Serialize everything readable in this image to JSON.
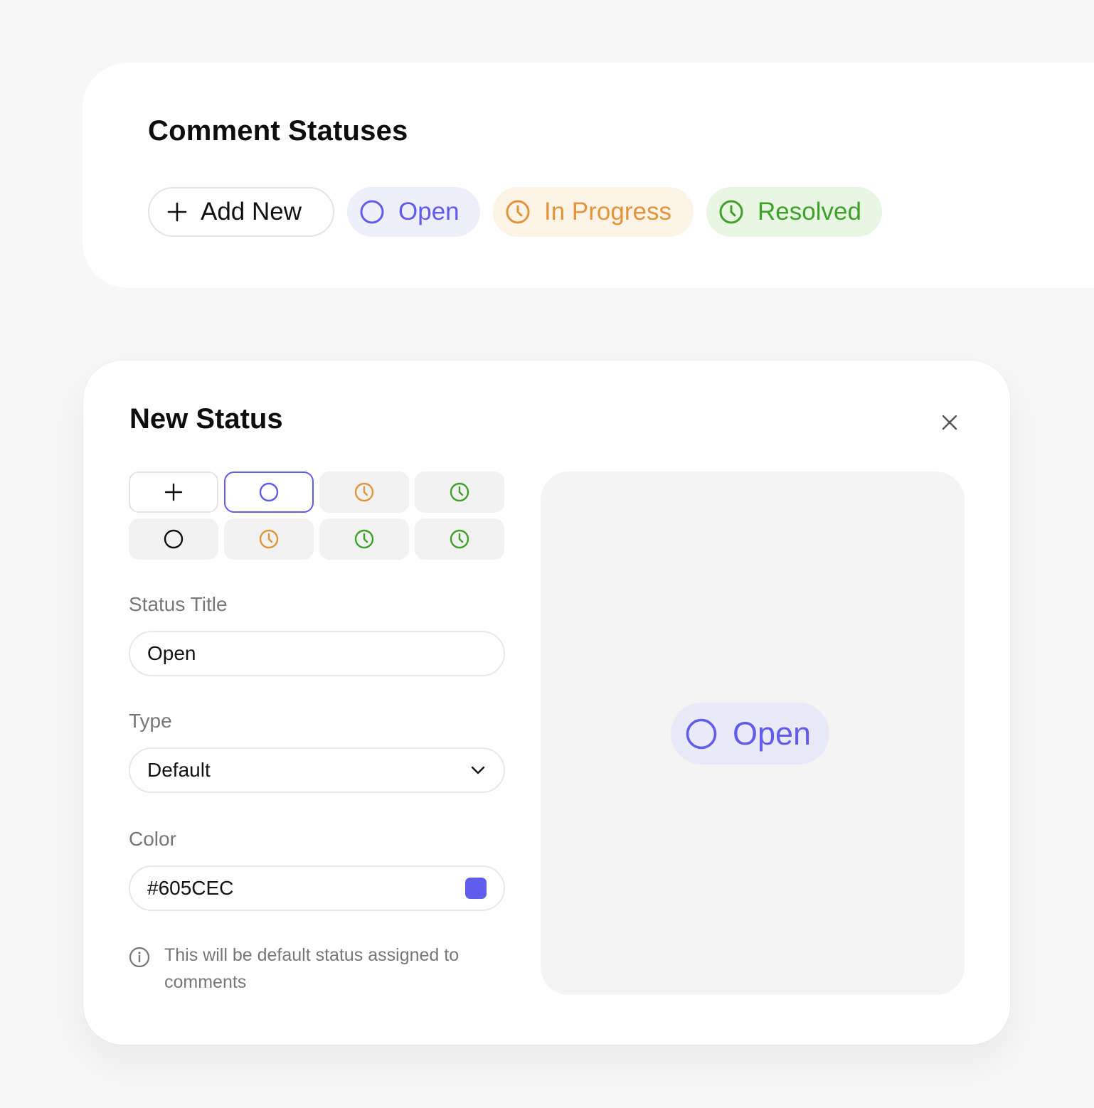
{
  "colors": {
    "open": "#605CEC",
    "in_progress": "#E0953B",
    "resolved": "#3FA12A"
  },
  "statuses_panel": {
    "title": "Comment Statuses",
    "add_new_label": "Add New",
    "chips": [
      {
        "label": "Open",
        "icon": "circle-icon",
        "color": "#605CEC"
      },
      {
        "label": "In Progress",
        "icon": "clock-icon",
        "color": "#E0953B"
      },
      {
        "label": "Resolved",
        "icon": "clock-icon",
        "color": "#3FA12A"
      }
    ]
  },
  "new_status_modal": {
    "title": "New Status",
    "close_icon": "close-icon",
    "icon_options": [
      {
        "icon": "plus-icon"
      },
      {
        "icon": "circle-icon",
        "selected": true
      },
      {
        "icon": "clock-icon"
      },
      {
        "icon": "clock-icon"
      },
      {
        "icon": "circle-icon"
      },
      {
        "icon": "clock-icon"
      },
      {
        "icon": "clock-icon"
      },
      {
        "icon": "clock-icon"
      }
    ],
    "status_title": {
      "label": "Status Title",
      "value": "Open"
    },
    "type": {
      "label": "Type",
      "value": "Default"
    },
    "color": {
      "label": "Color",
      "value": "#605CEC"
    },
    "hint": "This will be default status assigned to comments",
    "preview": {
      "label": "Open"
    }
  }
}
